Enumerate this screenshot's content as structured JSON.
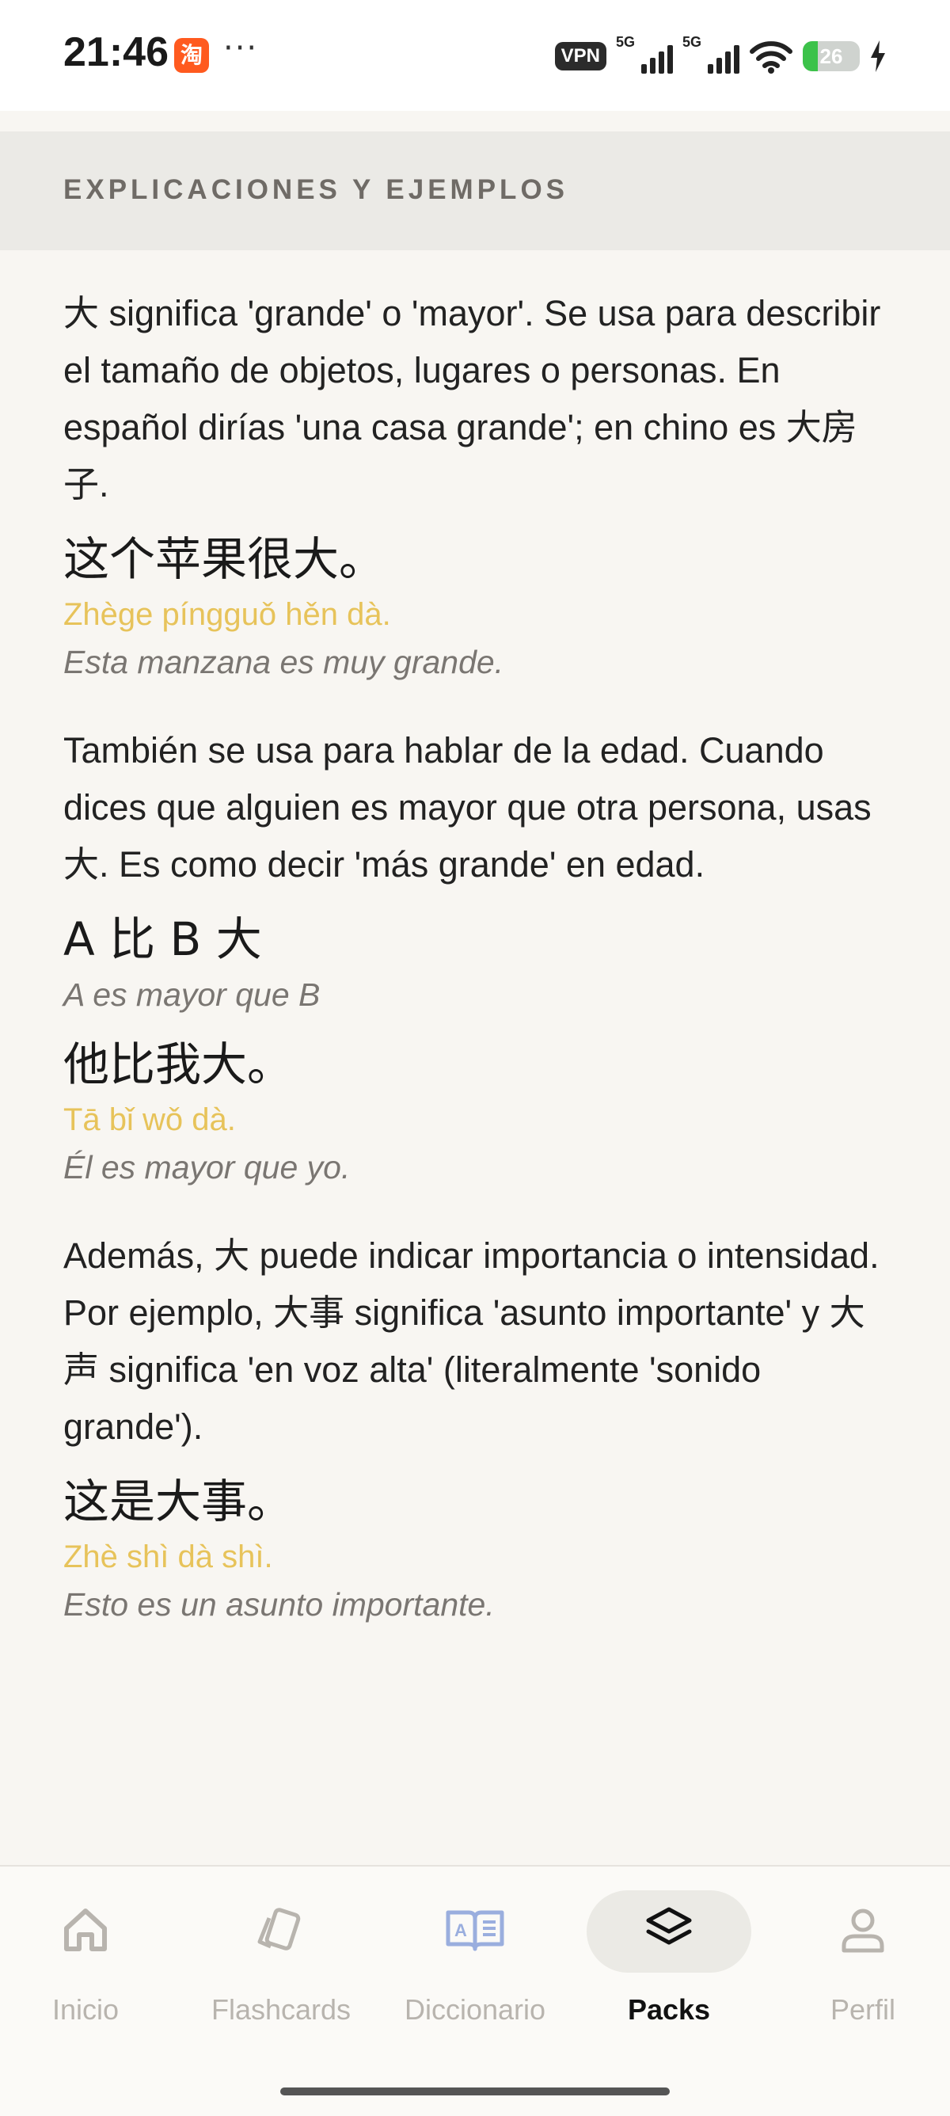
{
  "status_bar": {
    "time": "21:46",
    "app_icon_glyph": "淘",
    "more": "···",
    "vpn": "VPN",
    "network_1": "5G",
    "network_2": "5G",
    "battery_level": "26",
    "battery_fraction": 0.26,
    "accent_battery": "#3cc24a"
  },
  "section": {
    "title": "EXPLICACIONES Y EJEMPLOS"
  },
  "blocks": [
    {
      "paragraph": "大 significa 'grande' o 'mayor'. Se usa para describir el tamaño de objetos, lugares o personas. En español dirías 'una casa grande'; en chino es 大房子.",
      "examples": [
        {
          "hanzi": "这个苹果很大。",
          "pinyin": "Zhège píngguǒ hěn dà.",
          "translation": "Esta manzana es muy grande."
        }
      ]
    },
    {
      "paragraph": "También se usa para hablar de la edad. Cuando dices que alguien es mayor que otra persona, usas 大. Es como decir 'más grande' en edad.",
      "examples": [
        {
          "hanzi": "A 比 B 大",
          "pinyin": "",
          "translation": "A es mayor que B"
        },
        {
          "hanzi": "他比我大。",
          "pinyin": "Tā bǐ wǒ dà.",
          "translation": "Él es mayor que yo."
        }
      ]
    },
    {
      "paragraph": "Además, 大 puede indicar importancia o intensidad. Por ejemplo, 大事 significa 'asunto importante' y 大声 significa 'en voz alta' (literalmente 'sonido grande').",
      "examples": [
        {
          "hanzi": "这是大事。",
          "pinyin": "Zhè shì dà shì.",
          "translation": "Esto es un asunto importante."
        }
      ]
    }
  ],
  "nav": {
    "items": [
      {
        "label": "Inicio",
        "icon": "home-icon"
      },
      {
        "label": "Flashcards",
        "icon": "cards-icon"
      },
      {
        "label": "Diccionario",
        "icon": "dictionary-icon"
      },
      {
        "label": "Packs",
        "icon": "layers-icon"
      },
      {
        "label": "Perfil",
        "icon": "person-icon"
      }
    ],
    "active": "Packs"
  },
  "colors": {
    "pinyin": "#e7c35a",
    "accent_dictionary": "#9aaede",
    "inactive": "#b8b4ae"
  }
}
